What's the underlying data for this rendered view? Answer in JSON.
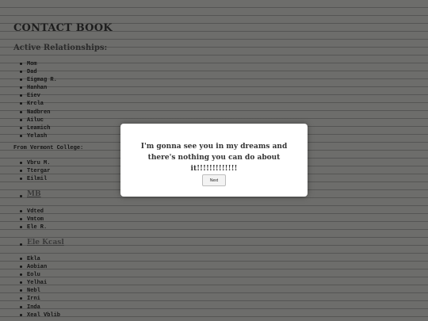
{
  "page": {
    "title": "CONTACT BOOK",
    "subtitle": "Active Relationships:",
    "active": [
      "Mom",
      "Dad",
      "Eigmag R.",
      "Hanhan",
      "Eiev",
      "Krcla",
      "Nadbren",
      "Ailuc",
      "Leamich",
      "Yelash"
    ],
    "college_label": "From Vermont College:",
    "college": [
      "Vbru M.",
      "Ttergar",
      "Eilmil"
    ],
    "group1_link": "MB",
    "group1": [
      "Vdted",
      "Vmtom",
      "Ele R."
    ],
    "group2_link": "Ele Kcasl",
    "group2": [
      "Ekla",
      "Aobian",
      "Eolu",
      "Yelhai",
      "Nebl",
      "Irni",
      "Inda",
      "Xeal Vblib"
    ]
  },
  "modal": {
    "message": "I'm gonna see you in my dreams and there's nothing you can do about it!!!!!!!!!!!!!",
    "button_label": "Next"
  }
}
